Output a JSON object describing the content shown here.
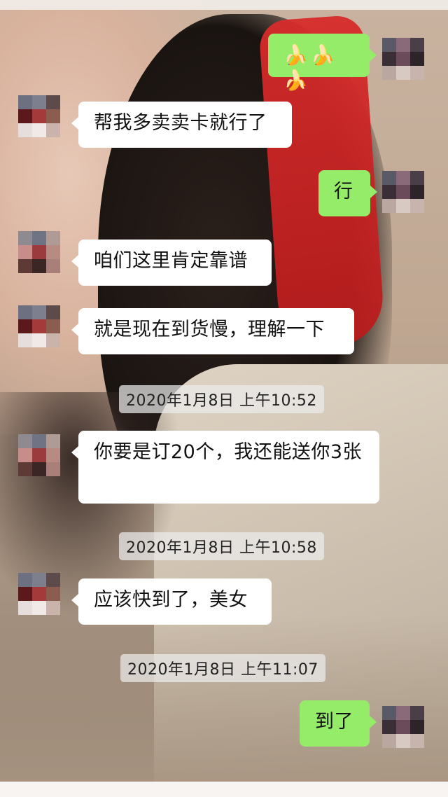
{
  "messages": [
    {
      "text": "🍌🍌🍌",
      "dir": "out"
    },
    {
      "text": "帮我多卖卖卡就行了",
      "dir": "in"
    },
    {
      "text": "行",
      "dir": "out"
    },
    {
      "text": "咱们这里肯定靠谱",
      "dir": "in"
    },
    {
      "text": "就是现在到货慢，理解一下",
      "dir": "in"
    },
    {
      "text": "你要是订20个，我还能送你3张",
      "dir": "in"
    },
    {
      "text": "应该快到了，美女",
      "dir": "in"
    },
    {
      "text": "到了",
      "dir": "out"
    }
  ],
  "timestamps": [
    "2020年1月8日 上午10:52",
    "2020年1月8日 上午10:58",
    "2020年1月8日 上午11:07"
  ],
  "colors": {
    "incoming_bubble": "#ffffff",
    "outgoing_bubble": "#95ec69"
  },
  "icons": {
    "banana_emoji": "banana-icon"
  }
}
